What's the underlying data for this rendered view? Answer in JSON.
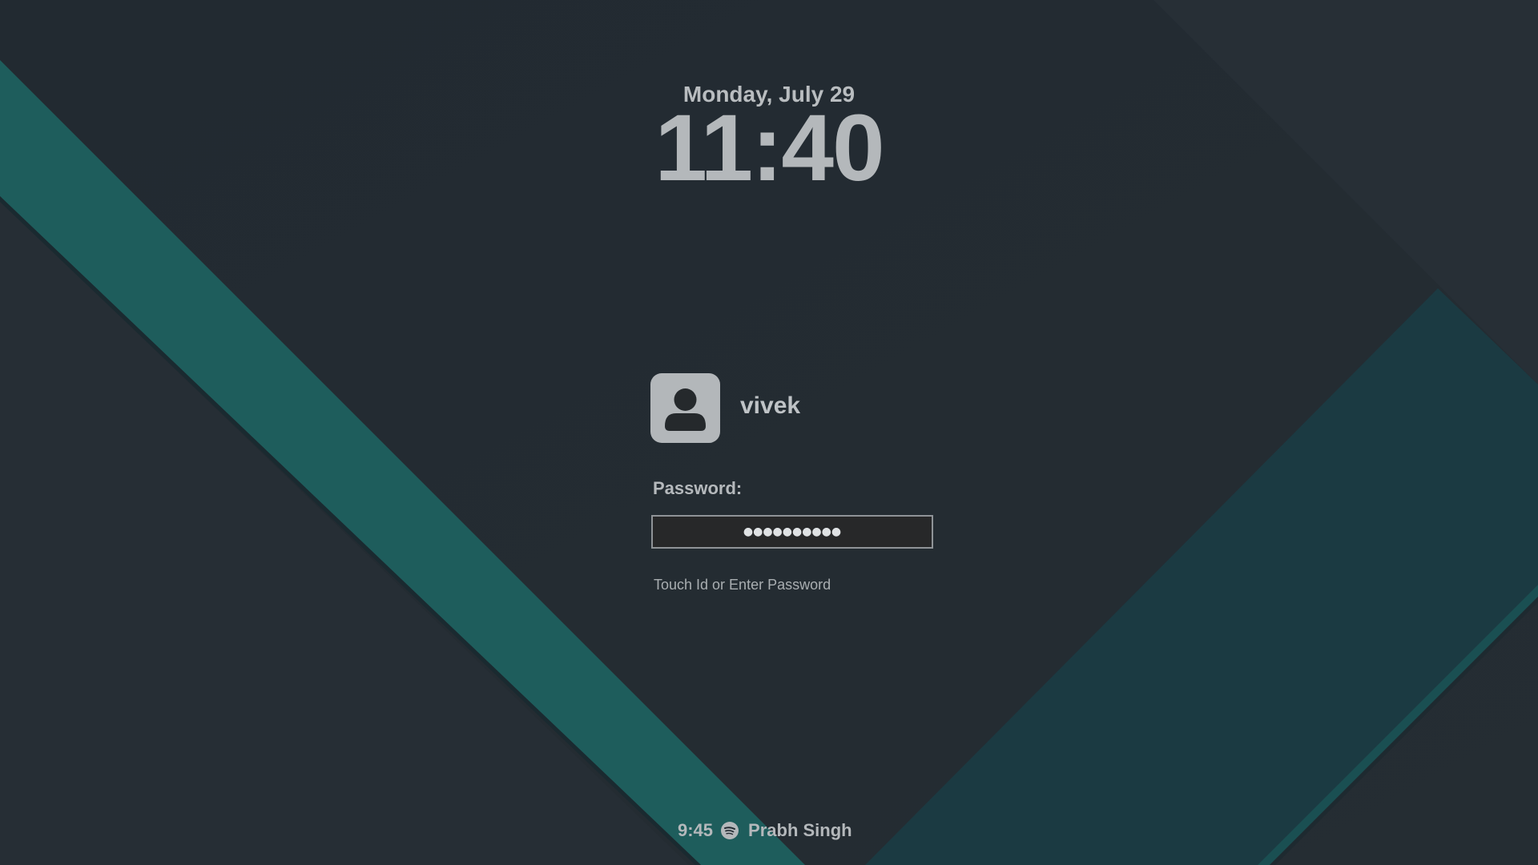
{
  "lock_screen": {
    "date": "Monday, July 29",
    "time": "11:40",
    "user": {
      "name": "vivek",
      "avatar_icon": "user-silhouette-icon"
    },
    "password": {
      "label": "Password:",
      "masked_value": "●●●●●●●●●●",
      "hint": "Touch Id or Enter Password"
    },
    "now_playing": {
      "time": "9:45",
      "app_icon": "spotify-icon",
      "artist": "Prabh Singh"
    }
  },
  "colors": {
    "background": "#232b32",
    "teal_stripe": "#1d5f5d",
    "teal_panel": "#1b3a42",
    "text": "#b7bcbf"
  }
}
